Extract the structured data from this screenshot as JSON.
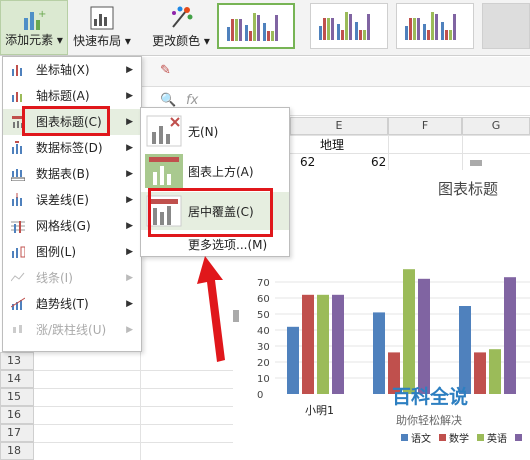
{
  "ribbon": {
    "add_element_label": "添加元素",
    "quick_layout_label": "快速布局",
    "change_color_label": "更改颜色"
  },
  "main_menu": {
    "items": [
      {
        "label": "坐标轴(X)",
        "icon": "axis-icon",
        "disabled": false
      },
      {
        "label": "轴标题(A)",
        "icon": "axis-title-icon",
        "disabled": false
      },
      {
        "label": "图表标题(C)",
        "icon": "chart-title-icon",
        "disabled": false
      },
      {
        "label": "数据标签(D)",
        "icon": "data-label-icon",
        "disabled": false
      },
      {
        "label": "数据表(B)",
        "icon": "data-table-icon",
        "disabled": false
      },
      {
        "label": "误差线(E)",
        "icon": "error-bar-icon",
        "disabled": false
      },
      {
        "label": "网格线(G)",
        "icon": "gridline-icon",
        "disabled": false
      },
      {
        "label": "图例(L)",
        "icon": "legend-icon",
        "disabled": false
      },
      {
        "label": "线条(I)",
        "icon": "lines-icon",
        "disabled": true
      },
      {
        "label": "趋势线(T)",
        "icon": "trendline-icon",
        "disabled": false
      },
      {
        "label": "涨/跌柱线(U)",
        "icon": "updown-bar-icon",
        "disabled": true
      }
    ]
  },
  "sub_menu": {
    "items": [
      {
        "label": "无(N)"
      },
      {
        "label": "图表上方(A)"
      },
      {
        "label": "居中覆盖(C)"
      }
    ],
    "more_label": "更多选项...(M)"
  },
  "sheet": {
    "formula_fx": "fx",
    "columns": [
      "E",
      "F",
      "G"
    ],
    "header_cell": "地理",
    "value_cells": [
      "62",
      "62"
    ],
    "rows": [
      "13",
      "14",
      "15",
      "16",
      "17",
      "18"
    ]
  },
  "chart_data": {
    "type": "bar",
    "title": "图表标题",
    "categories": [
      "小明1",
      "",
      ""
    ],
    "series": [
      {
        "name": "语文",
        "color": "#4f81bd",
        "values": [
          42,
          51,
          55
        ]
      },
      {
        "name": "数学",
        "color": "#c0504d",
        "values": [
          62,
          26,
          26
        ]
      },
      {
        "name": "英语",
        "color": "#9bbb59",
        "values": [
          62,
          78,
          28
        ]
      },
      {
        "name": "",
        "color": "#8064a2",
        "values": [
          62,
          72,
          73
        ]
      }
    ],
    "yticks": [
      "0",
      "10",
      "20",
      "30",
      "40",
      "50",
      "60",
      "70"
    ],
    "ylim": [
      0,
      80
    ]
  },
  "watermark": {
    "title": "百科全说",
    "subtitle": "助你轻松解决"
  }
}
